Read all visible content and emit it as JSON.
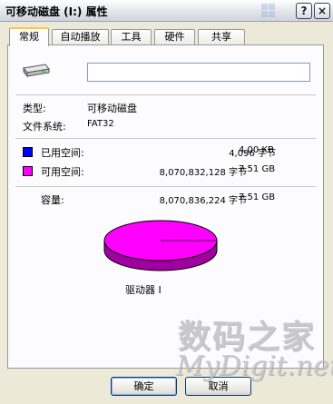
{
  "window": {
    "title": "可移动磁盘 (I:) 属性",
    "help_label": "?",
    "close_label": "×"
  },
  "tabs": [
    {
      "label": "常规",
      "active": true
    },
    {
      "label": "自动播放",
      "active": false
    },
    {
      "label": "工具",
      "active": false
    },
    {
      "label": "硬件",
      "active": false
    },
    {
      "label": "共享",
      "active": false
    }
  ],
  "general": {
    "volume_name_value": "",
    "type_label": "类型:",
    "type_value": "可移动磁盘",
    "fs_label": "文件系统:",
    "fs_value": "FAT32",
    "used_label": "已用空间:",
    "used_bytes": "4,096 字节",
    "used_size": "4.00 KB",
    "free_label": "可用空间:",
    "free_bytes": "8,070,832,128 字节",
    "free_size": "7.51 GB",
    "capacity_label": "容量:",
    "capacity_bytes": "8,070,836,224 字节",
    "capacity_size": "7.51 GB",
    "drive_label": "驱动器 I",
    "used_fraction": 5e-07,
    "used_color": "#0000ff",
    "free_color": "#ff00ff"
  },
  "buttons": {
    "ok": "确定",
    "cancel": "取消"
  },
  "watermark": {
    "line1": "数码之家",
    "line2": "MyDigit.net"
  },
  "icons": {
    "drive": "removable-drive-icon"
  }
}
